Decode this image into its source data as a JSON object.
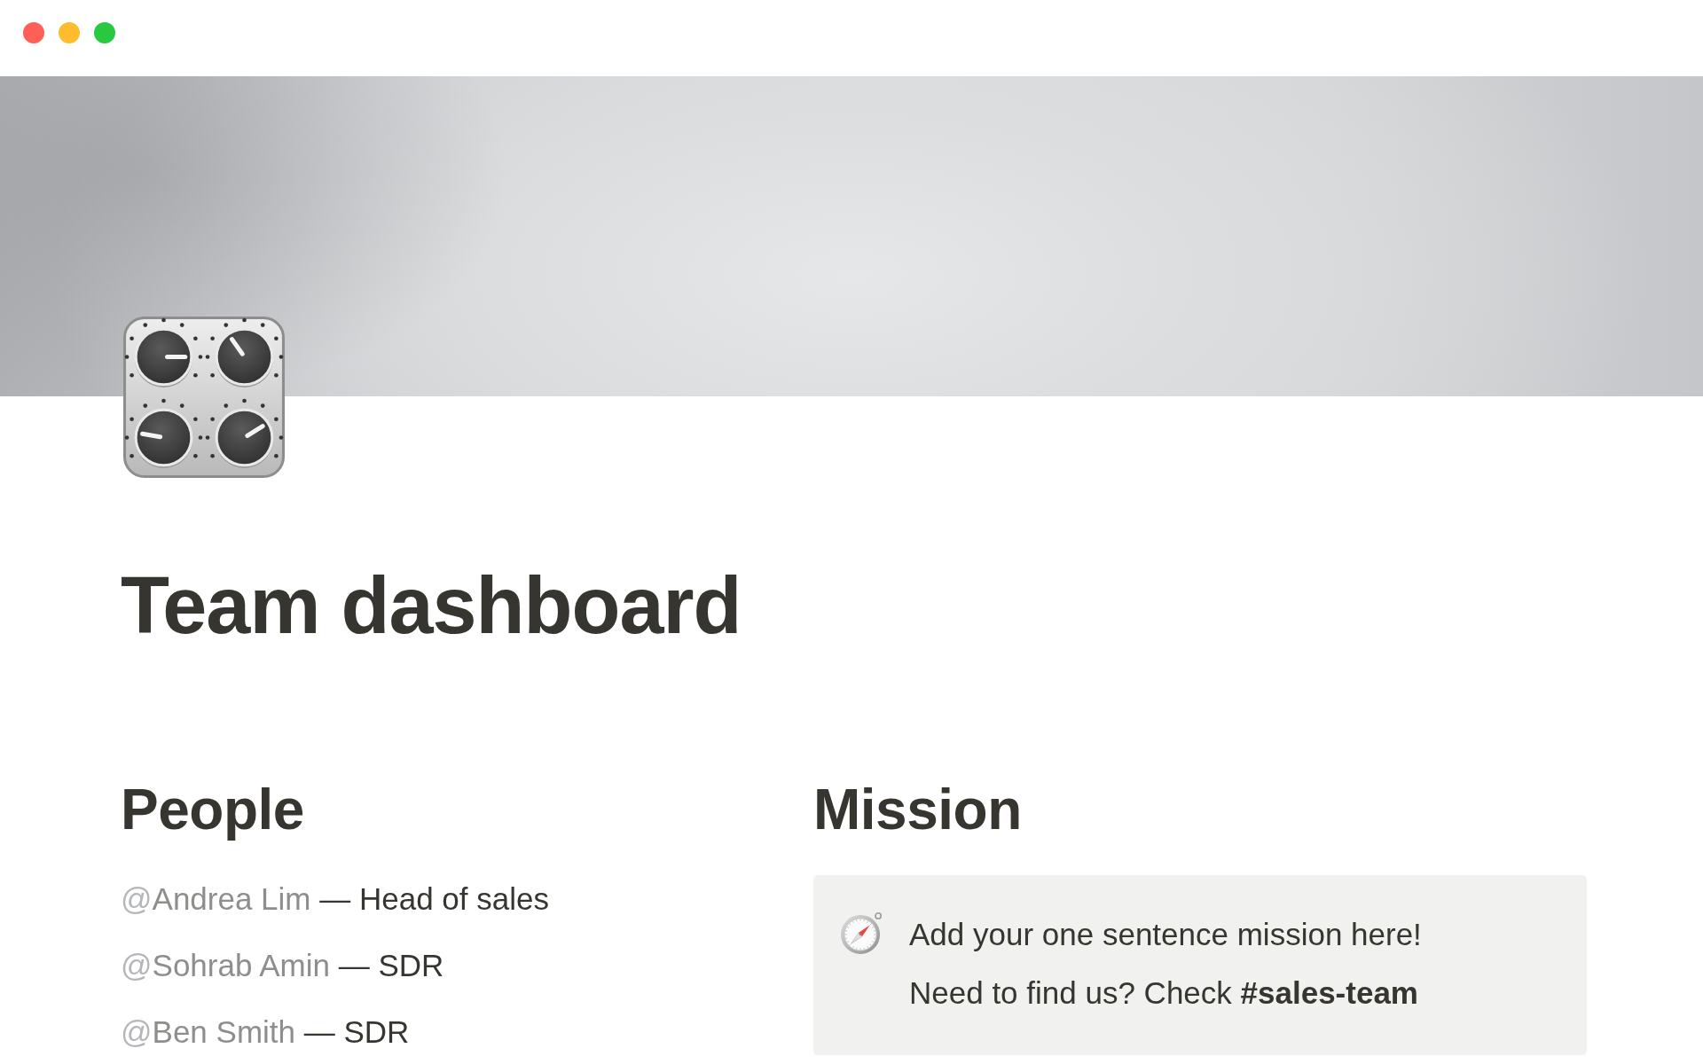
{
  "title": "Team dashboard",
  "people": {
    "heading": "People",
    "items": [
      {
        "at": "@",
        "name": "Andrea Lim",
        "role": "— Head of sales"
      },
      {
        "at": "@",
        "name": "Sohrab Amin",
        "role": "— SDR"
      },
      {
        "at": "@",
        "name": "Ben Smith",
        "role": "— SDR"
      }
    ]
  },
  "mission": {
    "heading": "Mission",
    "lines": [
      "Add your one sentence mission here!",
      "Need to find us? Check **#sales-team**"
    ]
  }
}
